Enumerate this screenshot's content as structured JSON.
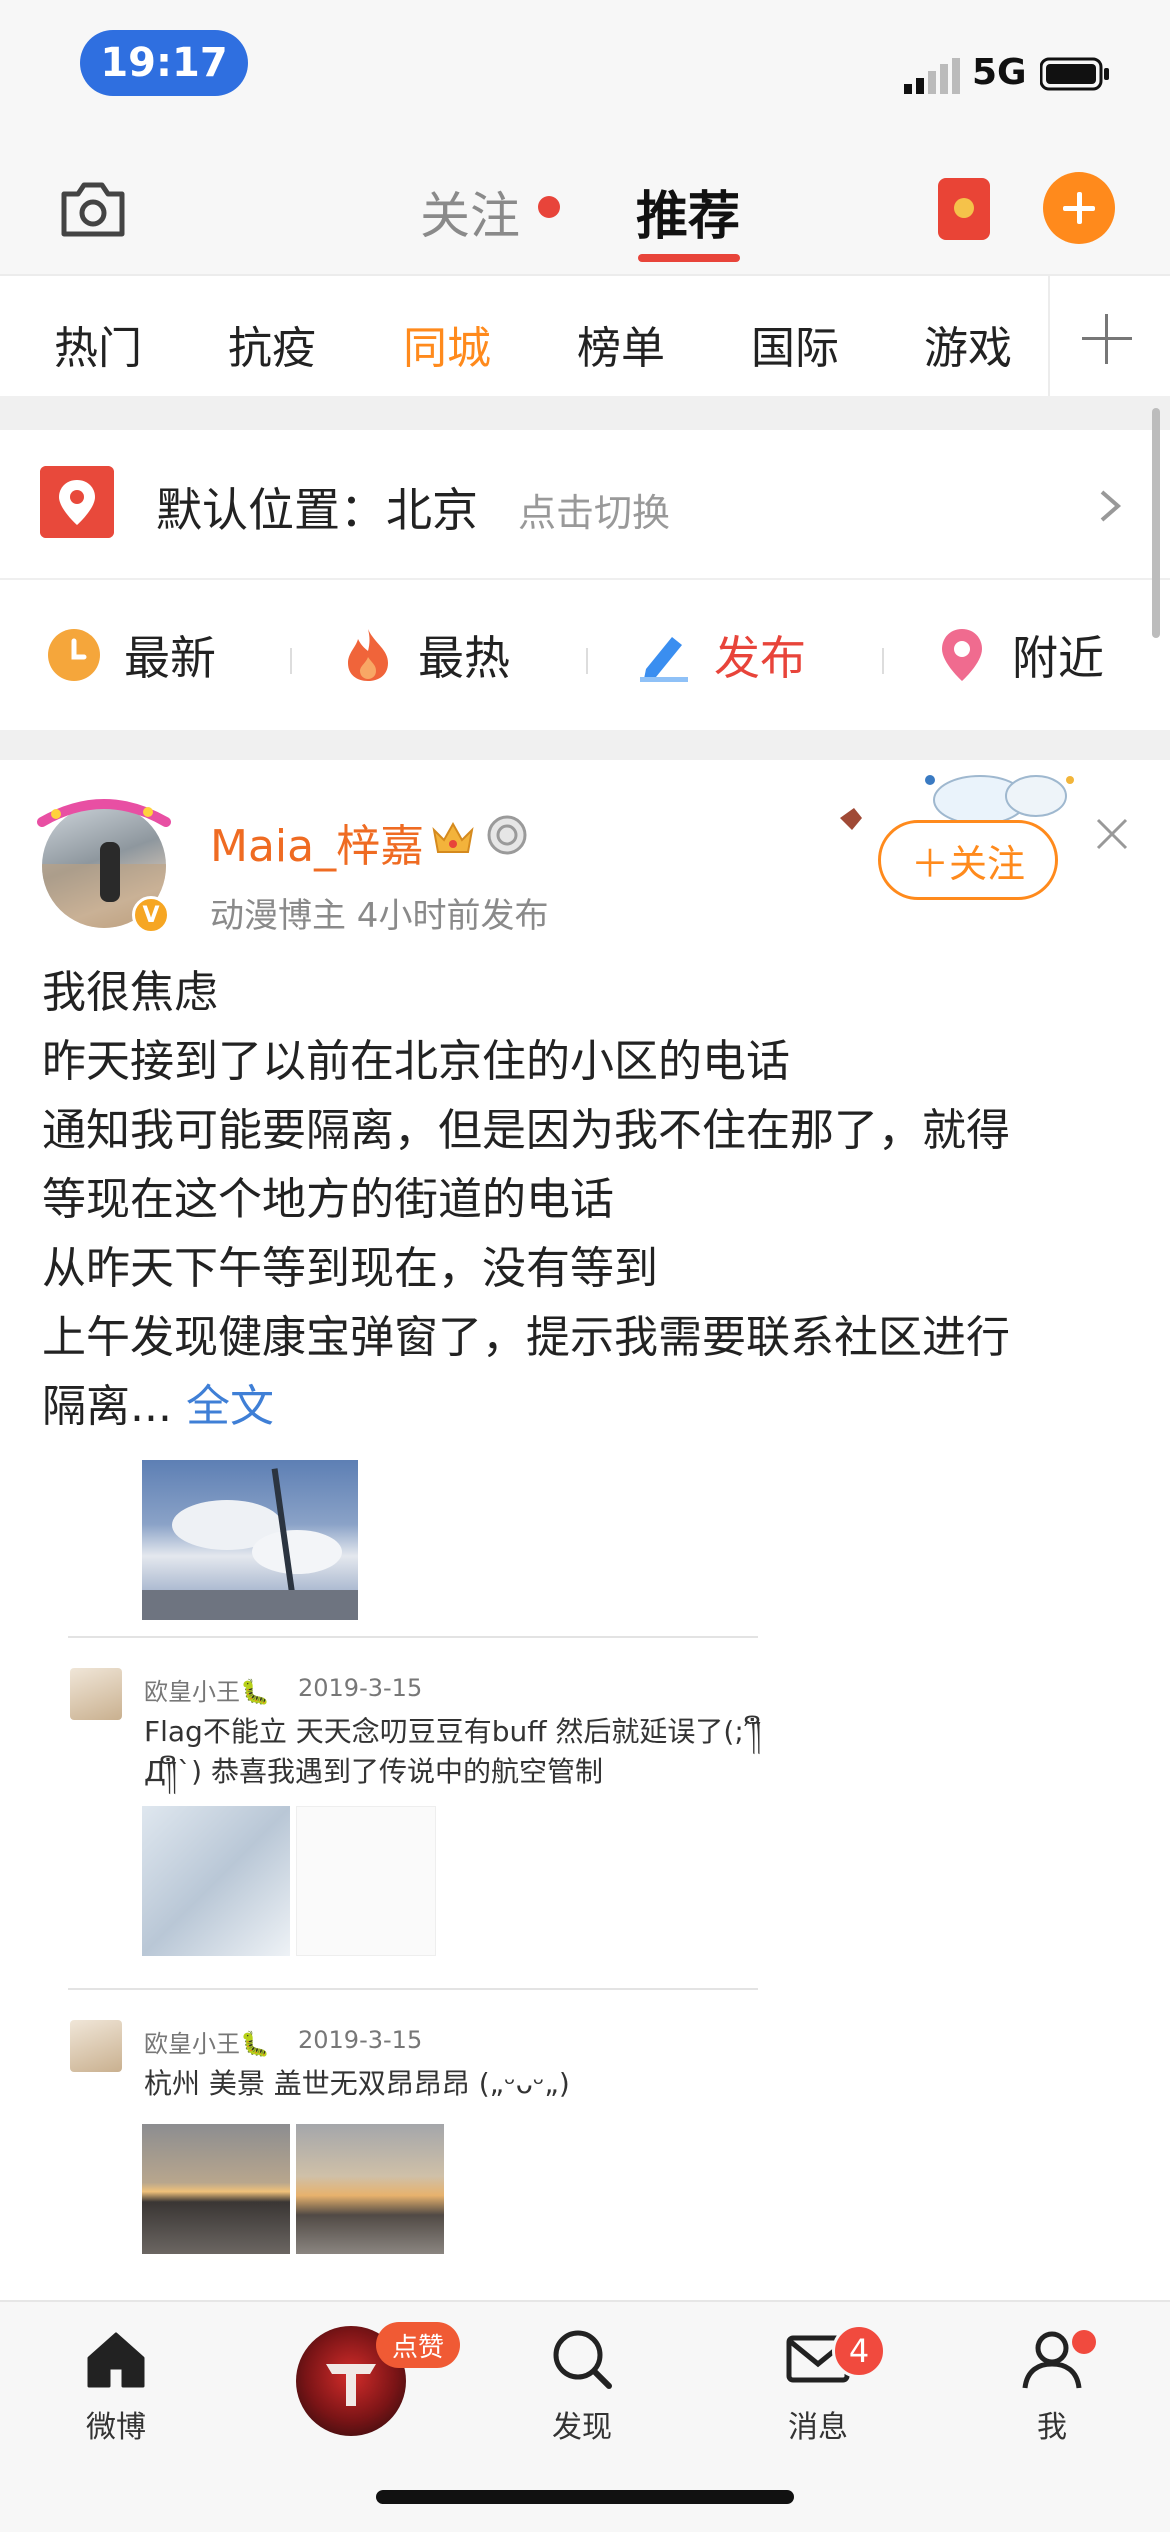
{
  "status_bar": {
    "time": "19:17",
    "network": "5G"
  },
  "top_nav": {
    "tabs": [
      {
        "label": "关注",
        "has_dot": true
      },
      {
        "label": "推荐",
        "active": true
      }
    ]
  },
  "channels": {
    "items": [
      {
        "label": "热门"
      },
      {
        "label": "抗疫"
      },
      {
        "label": "同城",
        "active": true
      },
      {
        "label": "榜单"
      },
      {
        "label": "国际"
      },
      {
        "label": "游戏"
      }
    ]
  },
  "location": {
    "label": "默认位置：北京",
    "switch_hint": "点击切换"
  },
  "filters": [
    {
      "label": "最新",
      "icon": "clock-icon"
    },
    {
      "label": "最热",
      "icon": "flame-icon"
    },
    {
      "label": "发布",
      "icon": "edit-icon"
    },
    {
      "label": "附近",
      "icon": "pin-icon"
    }
  ],
  "post": {
    "username": "Maia_梓嘉",
    "meta": "动漫博主  4小时前发布",
    "follow_label": "＋关注",
    "lines": [
      "我很焦虑",
      "昨天接到了以前在北京住的小区的电话",
      "通知我可能要隔离，但是因为我不住在那了，就得",
      "等现在这个地方的街道的电话",
      "从昨天下午等到现在，没有等到",
      "上午发现健康宝弹窗了，提示我需要联系社区进行"
    ],
    "last_line": "隔离...",
    "fulltext_label": "全文",
    "embedded": {
      "comments": [
        {
          "user": "欧皇小王🐛",
          "date": "2019-3-15",
          "text": "Flag不能立 天天念叨豆豆有buff 然后就延误了(;′༎ຶД༎ຶ`) 恭喜我遇到了传说中的航空管制"
        },
        {
          "user": "欧皇小王🐛",
          "date": "2019-3-15",
          "text": "杭州 美景 盖世无双昂昂昂 („ᵕᴗᵕ„)"
        }
      ]
    }
  },
  "tab_bar": {
    "items": [
      {
        "label": "微博",
        "icon": "home-icon"
      },
      {
        "label": "",
        "icon": "center-flag-icon",
        "badge": "点赞"
      },
      {
        "label": "发现",
        "icon": "search-icon"
      },
      {
        "label": "消息",
        "icon": "mail-icon",
        "badge": "4"
      },
      {
        "label": "我",
        "icon": "person-icon",
        "dot": true
      }
    ]
  },
  "colors": {
    "accent": "#ff8a1c",
    "red": "#e8443a",
    "link": "#3f7fd6"
  }
}
